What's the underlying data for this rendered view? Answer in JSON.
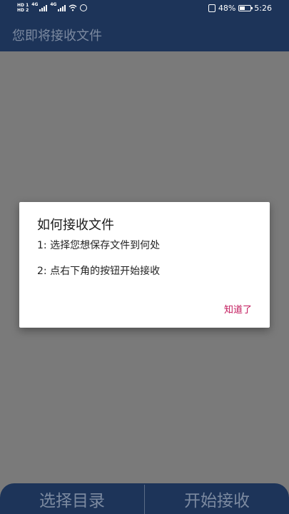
{
  "status_bar": {
    "sim1_label": "HD 1",
    "sim2_label": "HD 2",
    "network_label_1": "4G",
    "network_label_2": "4G",
    "battery_percent": "48%",
    "battery_level": 0.48,
    "time": "5:26"
  },
  "app_bar": {
    "title": "您即将接收文件"
  },
  "dialog": {
    "title": "如何接收文件",
    "line1": "1: 选择您想保存文件到何处",
    "line2": "2: 点右下角的按钮开始接收",
    "ok_label": "知道了",
    "accent_color": "#c2185b"
  },
  "bottom_bar": {
    "select_dir_label": "选择目录",
    "start_receive_label": "开始接收"
  },
  "colors": {
    "primary": "#1d3459",
    "scrim": "#7a7a7a"
  }
}
